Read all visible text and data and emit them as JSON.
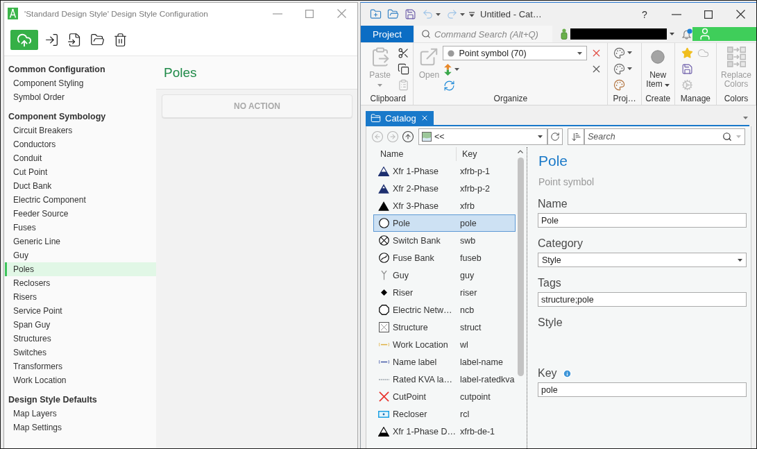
{
  "config_window": {
    "title": "'Standard Design Style' Design Style Configuration",
    "sidebar": [
      {
        "heading": "Common Configuration",
        "items": [
          {
            "label": "Component Styling",
            "selected": false
          },
          {
            "label": "Symbol Order",
            "selected": false
          }
        ]
      },
      {
        "heading": "Component Symbology",
        "items": [
          {
            "label": "Circuit Breakers",
            "selected": false
          },
          {
            "label": "Conductors",
            "selected": false
          },
          {
            "label": "Conduit",
            "selected": false
          },
          {
            "label": "Cut Point",
            "selected": false
          },
          {
            "label": "Duct Bank",
            "selected": false
          },
          {
            "label": "Electric Component",
            "selected": false
          },
          {
            "label": "Feeder Source",
            "selected": false
          },
          {
            "label": "Fuses",
            "selected": false
          },
          {
            "label": "Generic Line",
            "selected": false
          },
          {
            "label": "Guy",
            "selected": false
          },
          {
            "label": "Poles",
            "selected": true
          },
          {
            "label": "Reclosers",
            "selected": false
          },
          {
            "label": "Risers",
            "selected": false
          },
          {
            "label": "Service Point",
            "selected": false
          },
          {
            "label": "Span Guy",
            "selected": false
          },
          {
            "label": "Structures",
            "selected": false
          },
          {
            "label": "Switches",
            "selected": false
          },
          {
            "label": "Transformers",
            "selected": false
          },
          {
            "label": "Work Location",
            "selected": false
          }
        ]
      },
      {
        "heading": "Design Style Defaults",
        "items": [
          {
            "label": "Map Layers",
            "selected": false
          },
          {
            "label": "Map Settings",
            "selected": false
          }
        ]
      }
    ],
    "page": {
      "title": "Poles",
      "action": "NO ACTION"
    }
  },
  "catalog_window": {
    "quick_access": [
      {
        "kind": "new",
        "disabled": false
      },
      {
        "kind": "open-folder",
        "disabled": false
      },
      {
        "kind": "save",
        "disabled": false
      },
      {
        "kind": "undo",
        "disabled": true,
        "dropdown": true
      },
      {
        "kind": "redo",
        "disabled": true,
        "dropdown": true
      }
    ],
    "title": "Untitled - Cat…",
    "help": "?",
    "project_button": "Project",
    "command_search": {
      "placeholder": "Command Search (Alt+Q)"
    },
    "ribbon": [
      {
        "label": "Clipboard",
        "columns": [
          [
            {
              "kind": "paste",
              "label": "Paste",
              "disabled": true,
              "dropdown": true
            }
          ],
          [
            {
              "kind": "cut",
              "disabled": false
            },
            {
              "kind": "copy",
              "disabled": false
            },
            {
              "kind": "paste-special",
              "disabled": true
            }
          ]
        ]
      },
      {
        "label": "Organize",
        "columns": [
          [
            {
              "kind": "open",
              "label": "Open",
              "disabled": true
            }
          ],
          [
            {
              "kind": "filter",
              "value": "Point symbol (70)"
            },
            {
              "kind": "sort",
              "disabled": false,
              "dropdown": true
            },
            {
              "kind": "refresh",
              "disabled": false
            }
          ],
          [
            {
              "kind": "delete",
              "disabled": false
            },
            {
              "kind": "clear",
              "disabled": false
            }
          ]
        ]
      },
      {
        "label": "Proj…",
        "columns": [
          [
            {
              "kind": "add-style",
              "disabled": false,
              "dropdown": true
            },
            {
              "kind": "new-style",
              "disabled": false,
              "dropdown": true
            },
            {
              "kind": "import-style",
              "disabled": false
            }
          ]
        ]
      },
      {
        "label": "Create",
        "columns": [
          [
            {
              "kind": "new-item",
              "label": "New Item",
              "disabled": false,
              "dropdown": true
            }
          ]
        ]
      },
      {
        "label": "Manage",
        "columns": [
          [
            {
              "kind": "favorite",
              "disabled": false
            },
            {
              "kind": "edit-save",
              "disabled": false
            },
            {
              "kind": "upgrade",
              "disabled": true
            }
          ],
          [
            {
              "kind": "cloud",
              "disabled": true
            }
          ]
        ]
      },
      {
        "label": "Colors",
        "columns": [
          [
            {
              "kind": "replace-colors",
              "label": "Replace Colors",
              "disabled": true
            }
          ]
        ]
      }
    ],
    "dock_tabs": [
      {
        "label": "Catalog",
        "selected": true
      }
    ],
    "navigation": [
      {
        "kind": "back",
        "disabled": true
      },
      {
        "kind": "forward",
        "disabled": true
      },
      {
        "kind": "up",
        "disabled": false
      }
    ],
    "location": "<<",
    "search": {
      "placeholder": "Search"
    },
    "list": {
      "columns": [
        "Name",
        "Key"
      ],
      "rows": [
        {
          "name": "Xfr 1-Phase",
          "key": "xfrb-p-1",
          "kind": "xfr-1",
          "selected": false
        },
        {
          "name": "Xfr 2-Phase",
          "key": "xfrb-p-2",
          "kind": "xfr-2",
          "selected": false
        },
        {
          "name": "Xfr 3-Phase",
          "key": "xfrb",
          "kind": "xfr-3",
          "selected": false
        },
        {
          "name": "Pole",
          "key": "pole",
          "kind": "circle",
          "selected": true
        },
        {
          "name": "Switch Bank",
          "key": "swb",
          "kind": "circle-x",
          "selected": false
        },
        {
          "name": "Fuse Bank",
          "key": "fuseb",
          "kind": "circle-s",
          "selected": false
        },
        {
          "name": "Guy",
          "key": "guy",
          "kind": "guy",
          "selected": false
        },
        {
          "name": "Riser",
          "key": "riser",
          "kind": "diamond",
          "selected": false
        },
        {
          "name": "Electric Netw…",
          "key": "ncb",
          "kind": "octagon",
          "selected": false
        },
        {
          "name": "Structure",
          "key": "struct",
          "kind": "square-x",
          "selected": false
        },
        {
          "name": "Work Location",
          "key": "wl",
          "kind": "value-label",
          "selected": false
        },
        {
          "name": "Name label",
          "key": "label-name",
          "kind": "name-label",
          "selected": false
        },
        {
          "name": "Rated KVA la…",
          "key": "label-ratedkva",
          "kind": "dash-label",
          "selected": false
        },
        {
          "name": "CutPoint",
          "key": "cutpoint",
          "kind": "red-x",
          "selected": false
        },
        {
          "name": "Recloser",
          "key": "rcl",
          "kind": "recloser",
          "selected": false
        },
        {
          "name": "Xfr 1-Phase D…",
          "key": "xfrb-de-1",
          "kind": "xfr-de",
          "selected": false
        }
      ]
    },
    "details": {
      "title": "Pole",
      "subtitle": "Point symbol",
      "fields": [
        {
          "label": "Name",
          "kind": "text",
          "value": "Pole"
        },
        {
          "label": "Category",
          "kind": "select",
          "value": "Style"
        },
        {
          "label": "Tags",
          "kind": "text",
          "value": "structure;pole"
        },
        {
          "label": "Style",
          "kind": "preview"
        },
        {
          "label": "Key",
          "kind": "text",
          "value": "pole",
          "info": true
        }
      ]
    }
  }
}
